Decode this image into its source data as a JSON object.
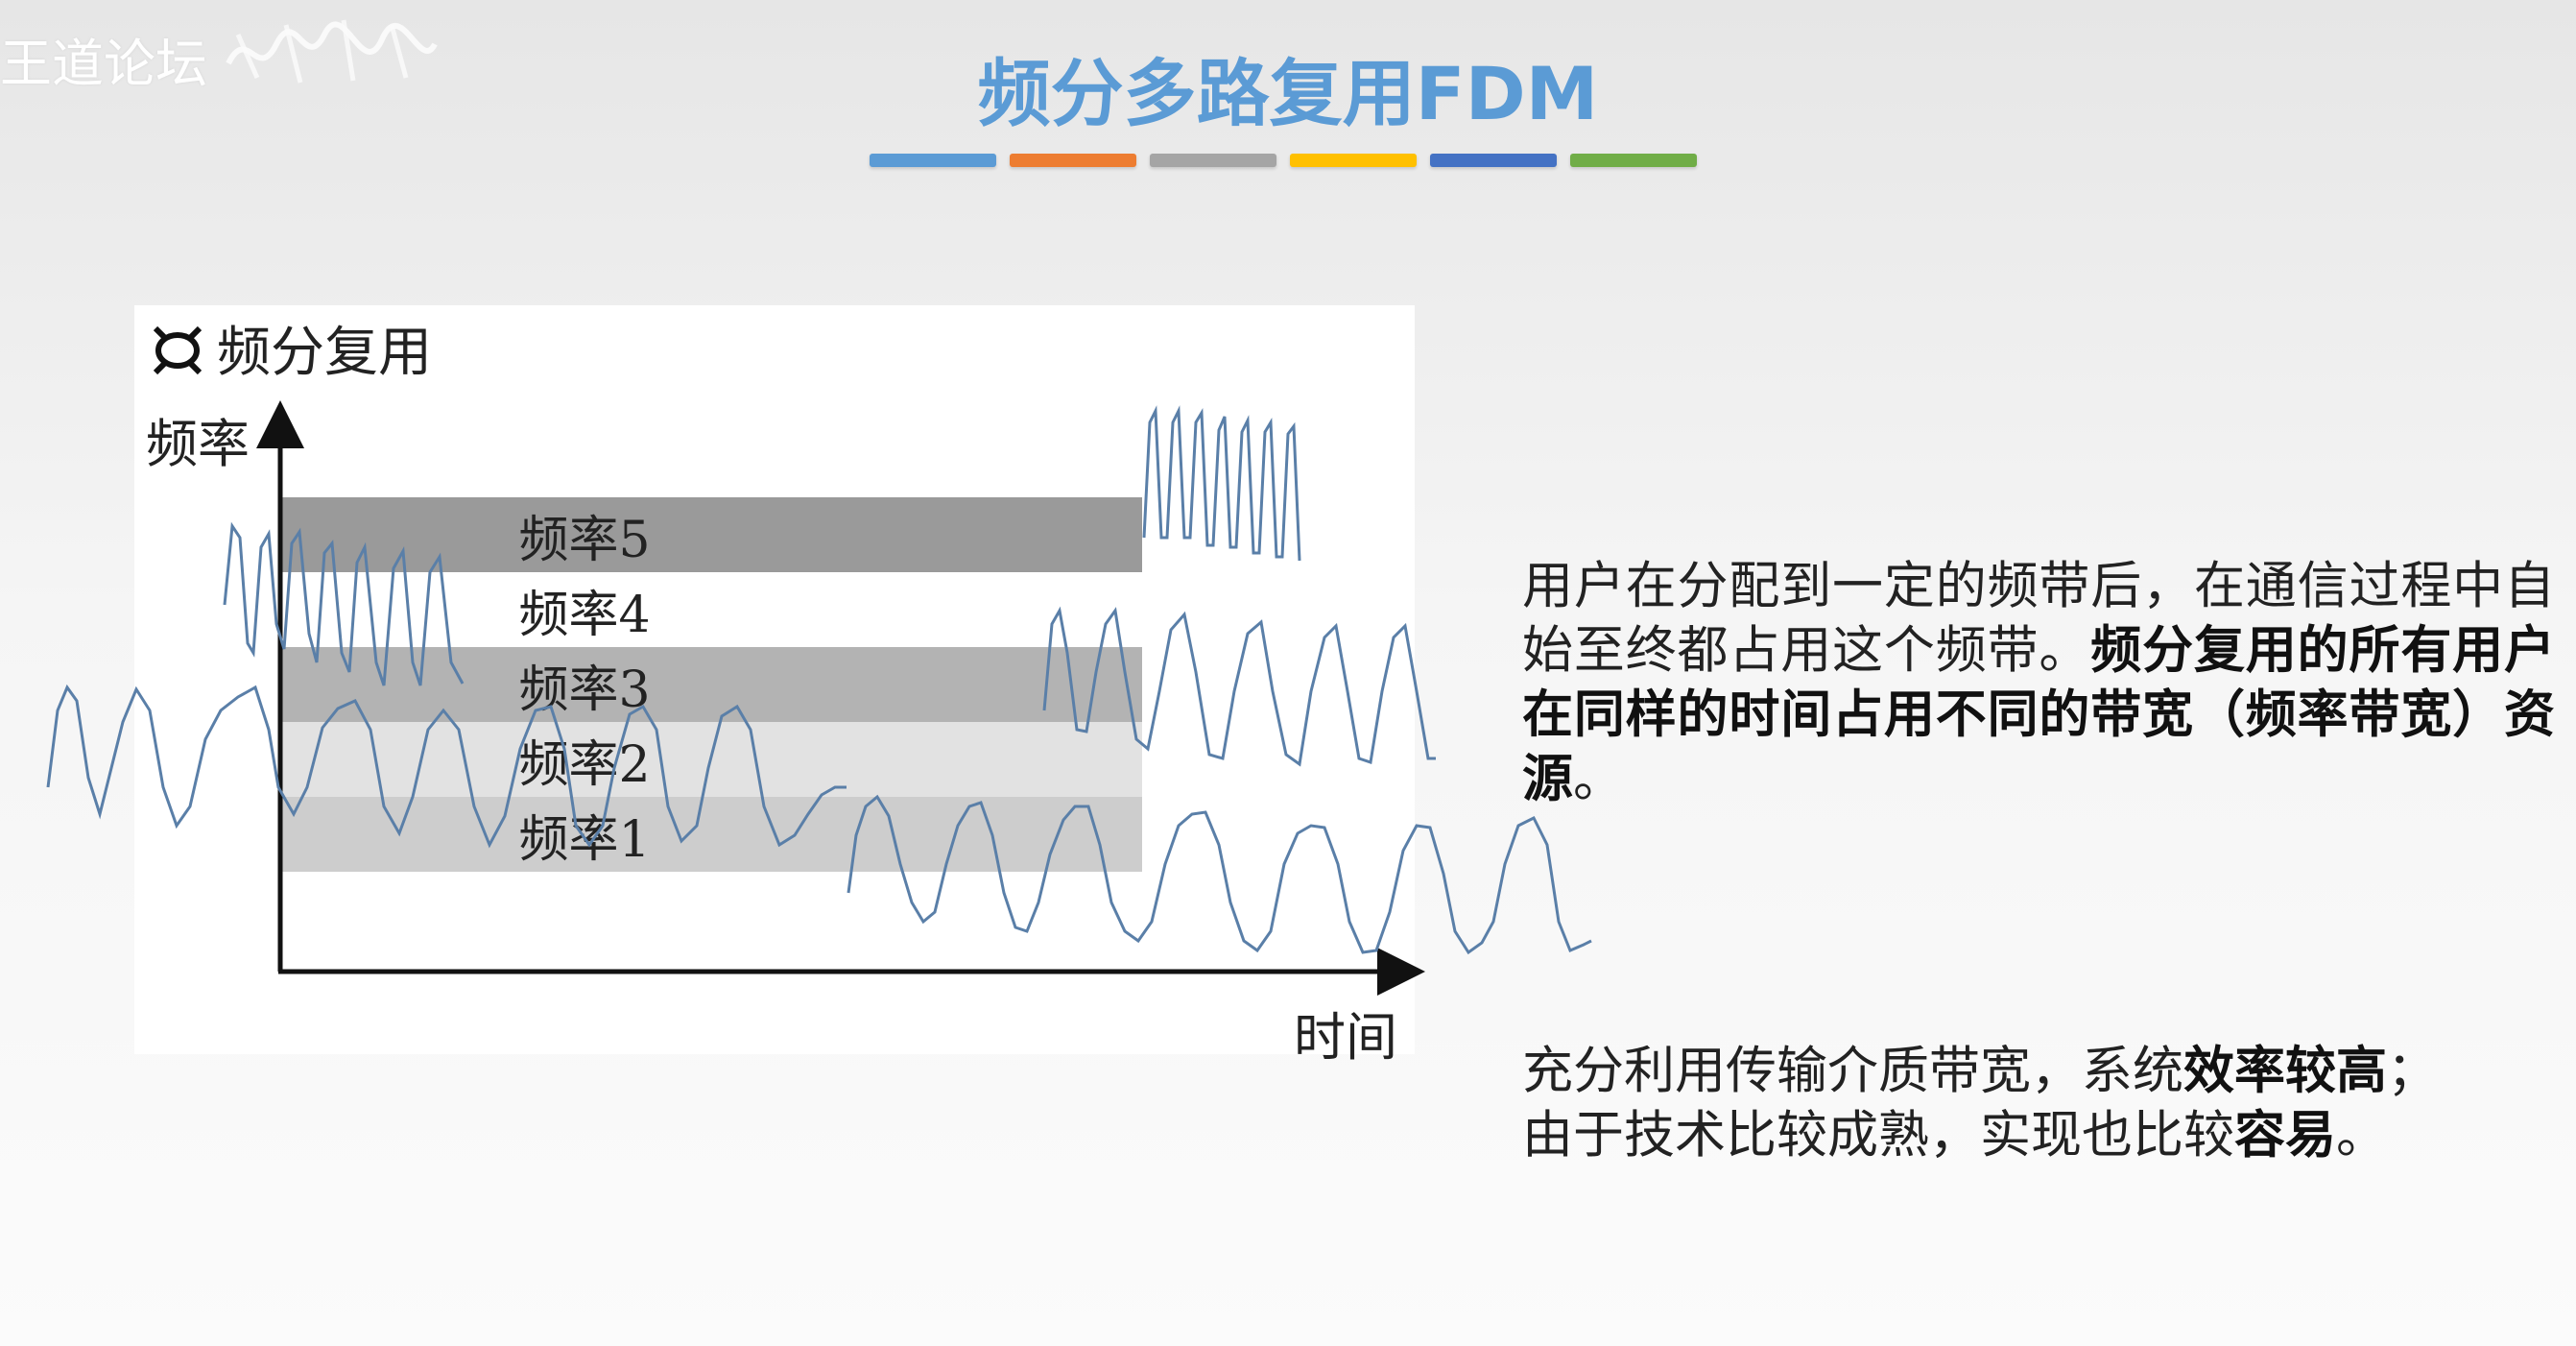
{
  "watermark": {
    "text": "王道论坛"
  },
  "slide": {
    "title": "频分多路复用FDM",
    "accent_colors": [
      "#5b9bd5",
      "#ed7d31",
      "#a5a5a5",
      "#ffc000",
      "#4472c4",
      "#70ad47"
    ]
  },
  "figure": {
    "heading": "频分复用",
    "heading_icon": "bullet-symbol-icon",
    "y_axis_label": "频率",
    "x_axis_label": "时间",
    "bands": [
      {
        "label": "频率5",
        "color": "#9a9a9a"
      },
      {
        "label": "频率4",
        "color": "#ffffff"
      },
      {
        "label": "频率3",
        "color": "#b3b3b3"
      },
      {
        "label": "频率2",
        "color": "#e2e2e2"
      },
      {
        "label": "频率1",
        "color": "#cdcdcd"
      }
    ],
    "wave_color": "#5a7fa8"
  },
  "description": {
    "line1": "用户在分配到一定的频带后，在通信过程中自始至终都占用这个频带。",
    "line2_bold": "频分复用的所有用户在同样的时间占用不同的带宽（频率带宽）资源",
    "line2_end": "。"
  },
  "advantages": {
    "a1_pre": "充分利用传输介质带宽，系统",
    "a1_bold": "效率较高",
    "a1_end": "；",
    "a2_pre": "由于技术比较成熟，实现也比较",
    "a2_bold": "容易",
    "a2_end": "。"
  }
}
